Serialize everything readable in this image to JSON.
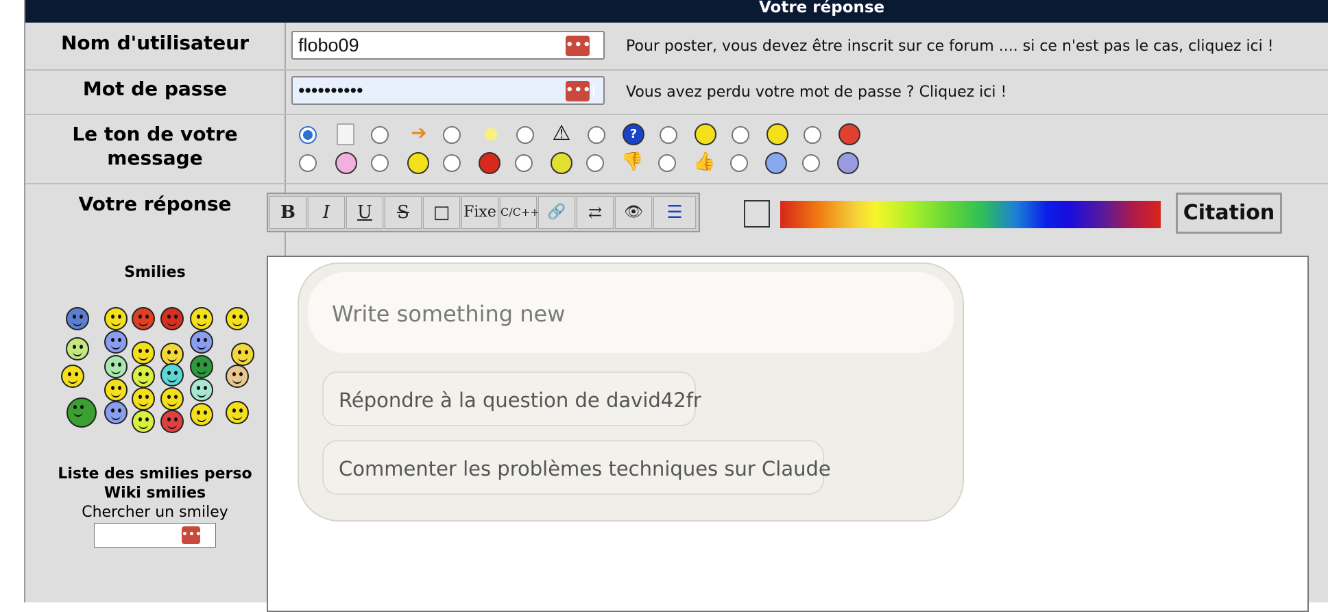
{
  "header": {
    "title": "Votre réponse"
  },
  "fields": {
    "username": {
      "label": "Nom d'utilisateur",
      "value": "flobo09",
      "hint": "Pour poster, vous devez être inscrit sur ce forum .... si ce n'est pas le cas, cliquez ici !"
    },
    "password": {
      "label": "Mot de passe",
      "value": "••••••••••",
      "hint": "Vous avez perdu votre mot de passe ? Cliquez ici !"
    }
  },
  "tone": {
    "label_line1": "Le ton de votre",
    "label_line2": "message",
    "row1": [
      "document-icon",
      "arrow-right-icon",
      "lightbulb-icon",
      "warning-icon",
      "question-icon",
      "cool-smiley-icon",
      "smile-icon",
      "angry-icon"
    ],
    "row2": [
      "sad-pink-icon",
      "grin-icon",
      "red-angry-icon",
      "wink-icon",
      "thumbs-down-icon",
      "thumbs-up-icon",
      "blue-worried-icon",
      "striped-smiley-icon"
    ],
    "selected_index": 0
  },
  "reply": {
    "label": "Votre réponse",
    "toolbar": [
      "B",
      "I",
      "U",
      "S",
      "□",
      "Fixe",
      "C/C++",
      "🔗",
      "⇄",
      "👁",
      "☰"
    ],
    "citation_label": "Citation"
  },
  "smilies": {
    "title": "Smilies",
    "links": [
      "Liste des smilies perso",
      "Wiki smilies"
    ],
    "search_label": "Chercher un smiley"
  },
  "suggest": {
    "placeholder": "Write something new",
    "chips": [
      "Répondre à la question de david42fr",
      "Commenter les problèmes techniques sur Claude"
    ]
  },
  "colors": {
    "header_bg": "#0b1a33",
    "accent": "#2f6fd3",
    "key_icon": "#c94a3c"
  }
}
